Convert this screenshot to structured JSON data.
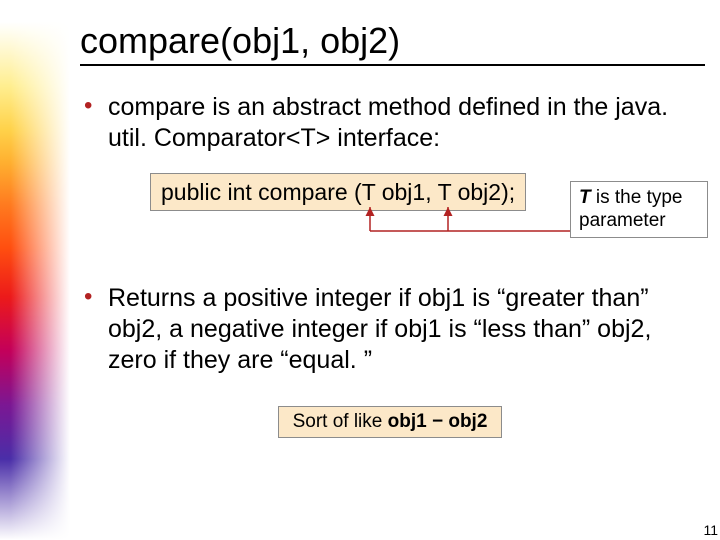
{
  "title": "compare(obj1, obj2)",
  "bullet1": "compare is an abstract method defined in the java. util. Comparator<T> interface:",
  "code_signature": "public int compare (T obj1, T obj2);",
  "callout_prefix": "T",
  "callout_rest": " is the type parameter",
  "bullet2": "Returns a positive integer if obj1 is “greater than” obj2, a negative integer if obj1 is “less than” obj2, zero if they are “equal. ”",
  "sortof_prefix": "Sort of like ",
  "sortof_expr": "obj1 − obj2",
  "page_number": "11"
}
